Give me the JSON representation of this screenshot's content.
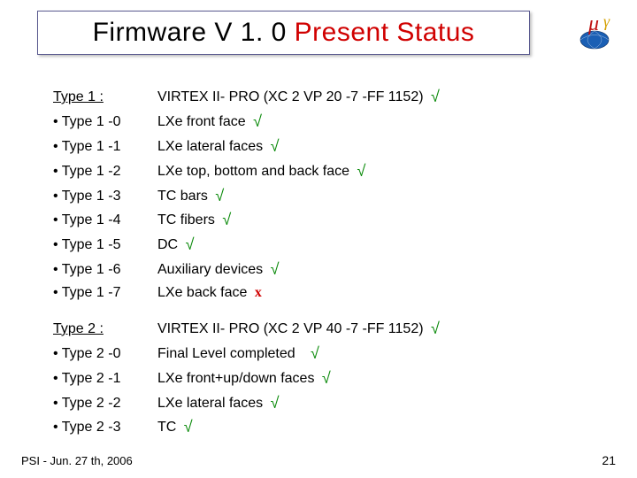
{
  "title": {
    "left": "Firmware V 1. 0 ",
    "right": "Present Status"
  },
  "sections": [
    {
      "header": {
        "label": "Type 1 :",
        "desc": "VIRTEX II- PRO (XC 2 VP 20 -7 -FF 1152)",
        "mark": "tick"
      },
      "rows": [
        {
          "label": "Type 1 -0",
          "desc": "LXe front face",
          "mark": "tick"
        },
        {
          "label": "Type 1 -1",
          "desc": "LXe lateral faces",
          "mark": "tick"
        },
        {
          "label": "Type 1 -2",
          "desc": "LXe top, bottom and back face",
          "mark": "tick"
        },
        {
          "label": "Type 1 -3",
          "desc": "TC bars",
          "mark": "tick"
        },
        {
          "label": "Type 1 -4",
          "desc": "TC fibers",
          "mark": "tick"
        },
        {
          "label": "Type 1 -5",
          "desc": "DC",
          "mark": "tick"
        },
        {
          "label": "Type 1 -6",
          "desc": "Auxiliary devices",
          "mark": "tick"
        },
        {
          "label": "Type 1 -7",
          "desc": "LXe back face",
          "mark": "cross"
        }
      ]
    },
    {
      "header": {
        "label": "Type 2 :",
        "desc": "VIRTEX II- PRO (XC 2 VP 40 -7 -FF 1152)",
        "mark": "tick"
      },
      "rows": [
        {
          "label": "Type 2 -0",
          "desc": "Final Level completed",
          "mark": "tick"
        },
        {
          "label": "Type 2 -1",
          "desc": "LXe front+up/down faces",
          "mark": "tick"
        },
        {
          "label": "Type 2 -2",
          "desc": "LXe lateral faces",
          "mark": "tick"
        },
        {
          "label": "Type 2 -3",
          "desc": "TC",
          "mark": "tick"
        }
      ]
    }
  ],
  "marks": {
    "tick": "√",
    "cross": "x"
  },
  "footer": {
    "left": "PSI - Jun. 27 th, 2006",
    "right": "21"
  }
}
